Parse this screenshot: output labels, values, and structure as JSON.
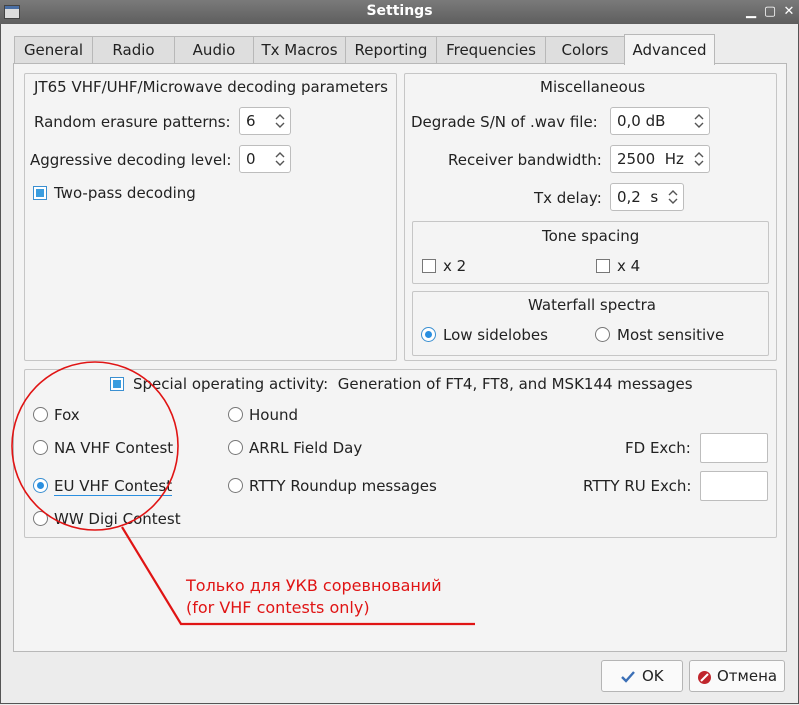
{
  "window": {
    "title": "Settings"
  },
  "tabs": [
    {
      "label": "General"
    },
    {
      "label": "Radio"
    },
    {
      "label": "Audio"
    },
    {
      "label": "Tx Macros"
    },
    {
      "label": "Reporting"
    },
    {
      "label": "Frequencies"
    },
    {
      "label": "Colors"
    },
    {
      "label": "Advanced"
    }
  ],
  "jt65": {
    "title": "JT65 VHF/UHF/Microwave decoding parameters",
    "random_erasure_label": "Random erasure patterns:",
    "random_erasure_value": "6",
    "aggressive_label": "Aggressive decoding level:",
    "aggressive_value": "0",
    "two_pass_label": "Two-pass decoding",
    "two_pass_checked": true
  },
  "misc": {
    "title": "Miscellaneous",
    "degrade_label": "Degrade S/N of .wav file:",
    "degrade_value": "0,0 dB",
    "bandwidth_label": "Receiver bandwidth:",
    "bandwidth_value": "2500  Hz",
    "tx_delay_label": "Tx delay:",
    "tx_delay_value": "0,2  s",
    "tone_spacing": {
      "title": "Tone spacing",
      "x2_label": "x 2",
      "x4_label": "x 4"
    },
    "waterfall": {
      "title": "Waterfall spectra",
      "low_label": "Low sidelobes",
      "most_label": "Most sensitive",
      "selected": "Low sidelobes"
    }
  },
  "special": {
    "title": "Special operating activity:  Generation of FT4, FT8, and MSK144 messages",
    "checked": true,
    "options": {
      "fox": "Fox",
      "hound": "Hound",
      "na_vhf": "NA VHF Contest",
      "arrl_fd": "ARRL Field Day",
      "eu_vhf": "EU VHF Contest",
      "rtty_ru": "RTTY Roundup messages",
      "ww_digi": "WW Digi Contest"
    },
    "selected": "EU VHF Contest",
    "fd_exch_label": "FD Exch:",
    "fd_exch_value": "",
    "rtty_exch_label": "RTTY RU Exch:",
    "rtty_exch_value": ""
  },
  "annotation": {
    "line1": "Только для УКВ соревнований",
    "line2": "(for VHF contests only)",
    "color": "#e01414"
  },
  "buttons": {
    "ok": "OK",
    "cancel": "Отмена"
  },
  "icons": {
    "ok": "check-icon",
    "cancel": "cancel-icon"
  }
}
